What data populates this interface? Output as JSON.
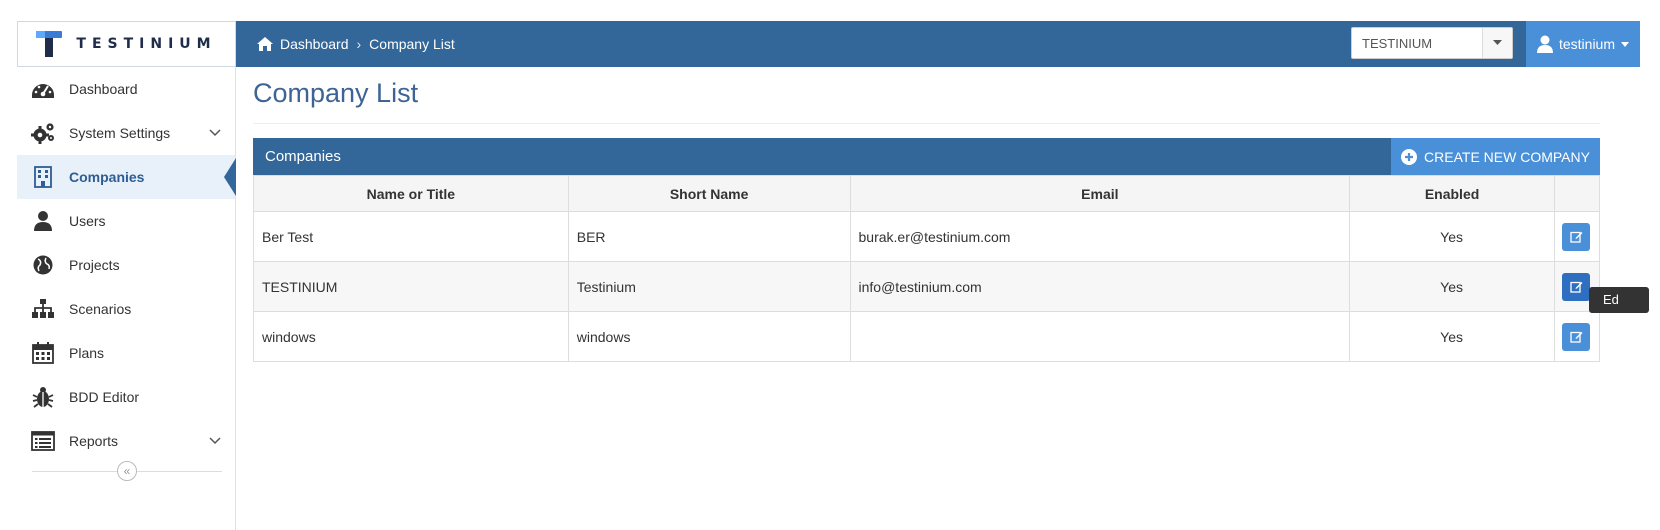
{
  "brand": {
    "name": "TESTINIUM",
    "color": "#336699",
    "accent": "#4a90d9"
  },
  "header": {
    "breadcrumb": [
      {
        "label": "Dashboard",
        "icon": "home-icon"
      },
      {
        "label": "Company List"
      }
    ],
    "org_select": {
      "value": "TESTINIUM"
    },
    "user_menu": {
      "label": "testinium",
      "icon": "user-icon"
    }
  },
  "sidebar": {
    "items": [
      {
        "label": "Dashboard",
        "icon": "dashboard-icon",
        "active": false,
        "expandable": false
      },
      {
        "label": "System Settings",
        "icon": "gears-icon",
        "active": false,
        "expandable": true
      },
      {
        "label": "Companies",
        "icon": "building-icon",
        "active": true,
        "expandable": false
      },
      {
        "label": "Users",
        "icon": "user-icon",
        "active": false,
        "expandable": false
      },
      {
        "label": "Projects",
        "icon": "globe-icon",
        "active": false,
        "expandable": false
      },
      {
        "label": "Scenarios",
        "icon": "sitemap-icon",
        "active": false,
        "expandable": false
      },
      {
        "label": "Plans",
        "icon": "calendar-icon",
        "active": false,
        "expandable": false
      },
      {
        "label": "BDD Editor",
        "icon": "bug-icon",
        "active": false,
        "expandable": false
      },
      {
        "label": "Reports",
        "icon": "report-list-icon",
        "active": false,
        "expandable": true
      }
    ],
    "collapse_glyph": "«"
  },
  "main": {
    "title": "Company List",
    "panel": {
      "title": "Companies",
      "create_button": "CREATE NEW COMPANY"
    },
    "table": {
      "columns": [
        "Name or Title",
        "Short Name",
        "Email",
        "Enabled",
        ""
      ],
      "rows": [
        {
          "name": "Ber Test",
          "short": "BER",
          "email": "burak.er@testinium.com",
          "enabled": "Yes"
        },
        {
          "name": "TESTINIUM",
          "short": "Testinium",
          "email": "info@testinium.com",
          "enabled": "Yes"
        },
        {
          "name": "windows",
          "short": "windows",
          "email": "",
          "enabled": "Yes"
        }
      ]
    },
    "tooltip": "Ed"
  }
}
